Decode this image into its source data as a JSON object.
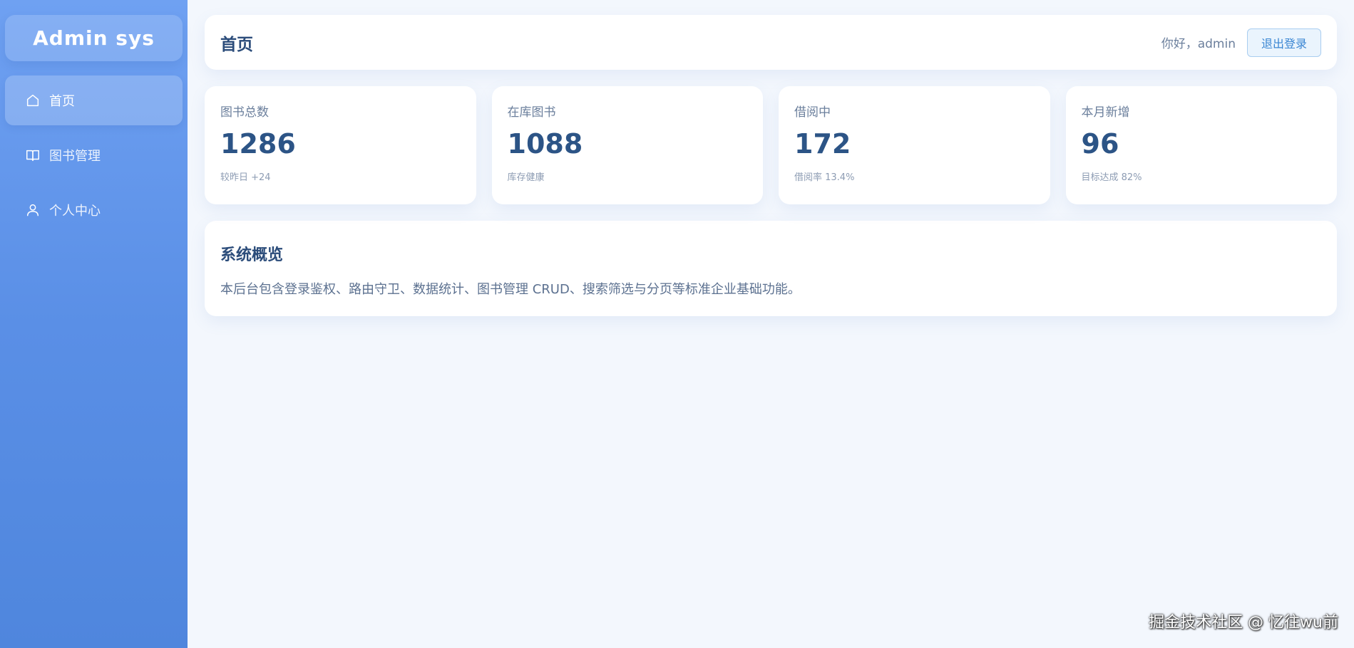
{
  "sidebar": {
    "brand": "Admin sys",
    "items": [
      {
        "label": "首页",
        "icon": "home-icon",
        "active": true
      },
      {
        "label": "图书管理",
        "icon": "book-icon",
        "active": false
      },
      {
        "label": "个人中心",
        "icon": "user-icon",
        "active": false
      }
    ]
  },
  "header": {
    "title": "首页",
    "greeting": "你好，admin",
    "logout_label": "退出登录"
  },
  "stats": [
    {
      "label": "图书总数",
      "value": "1286",
      "note": "较昨日 +24"
    },
    {
      "label": "在库图书",
      "value": "1088",
      "note": "库存健康"
    },
    {
      "label": "借阅中",
      "value": "172",
      "note": "借阅率 13.4%"
    },
    {
      "label": "本月新增",
      "value": "96",
      "note": "目标达成 82%"
    }
  ],
  "overview": {
    "title": "系统概览",
    "text": "本后台包含登录鉴权、路由守卫、数据统计、图书管理 CRUD、搜索筛选与分页等标准企业基础功能。"
  },
  "watermark": "掘金技术社区 @ 忆往wu前",
  "colors": {
    "sidebar_top": "#6fa1f2",
    "sidebar_bottom": "#4f86dd",
    "page_bg": "#f3f7fd",
    "accent": "#3a86d3",
    "title": "#2b4c7a"
  }
}
